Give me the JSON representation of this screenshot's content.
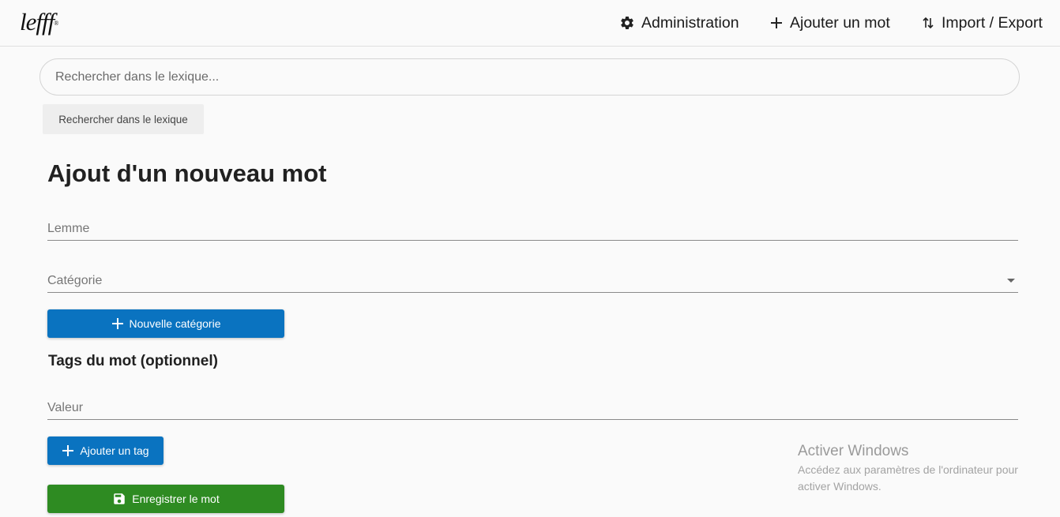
{
  "header": {
    "logo_text": "lefff",
    "logo_mark": "®",
    "nav": {
      "admin_label": "Administration",
      "admin_icon": "gear-icon",
      "add_word_label": "Ajouter un mot",
      "add_word_icon": "plus-icon",
      "import_export_label": "Import / Export",
      "import_export_icon": "swap-vertical-icon"
    }
  },
  "search": {
    "placeholder": "Rechercher dans le lexique...",
    "value": "",
    "button_label": "Rechercher dans le lexique"
  },
  "form": {
    "title": "Ajout d'un nouveau mot",
    "lemme_placeholder": "Lemme",
    "categorie_label": "Catégorie",
    "new_category_label": "Nouvelle catégorie",
    "tags_title": "Tags du mot (optionnel)",
    "valeur_placeholder": "Valeur",
    "add_tag_label": "Ajouter un tag",
    "save_label": "Enregistrer le mot",
    "save_icon": "floppy-disk-icon"
  },
  "watermark": {
    "title": "Activer Windows",
    "subtitle": "Accédez aux paramètres de l'ordinateur pour activer Windows."
  },
  "colors": {
    "primary": "#0a73c0",
    "success": "#2e8b22",
    "background": "#fafafa"
  }
}
